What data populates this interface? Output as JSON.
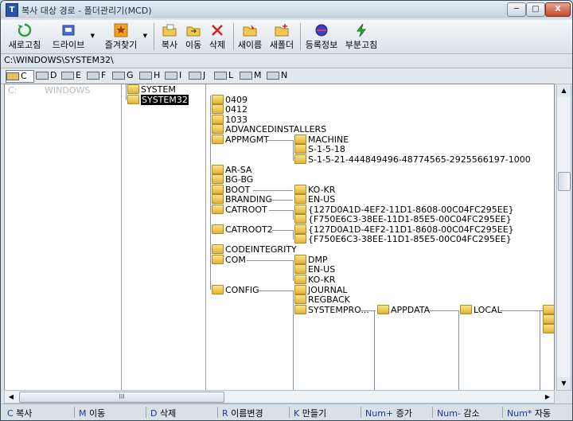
{
  "window": {
    "title": "복사 대상 경로 - 폴더관리기(MCD)",
    "icon_letter": "T"
  },
  "controls": {
    "minimize": "─",
    "maximize": "□",
    "close": "X"
  },
  "toolbar": {
    "refresh": "새로고침",
    "drive": "드라이브",
    "favorites": "즐겨찾기",
    "copy": "복사",
    "move": "이동",
    "delete": "삭제",
    "rename": "새이름",
    "new_folder": "새폴더",
    "properties": "등록정보",
    "partial_refresh": "부분고침"
  },
  "current_path": "C:\\WINDOWS\\SYSTEM32\\",
  "drives": [
    "C",
    "D",
    "E",
    "F",
    "G",
    "H",
    "I",
    "J",
    "L",
    "M",
    "N"
  ],
  "columns": {
    "col1": {
      "drive": "C:",
      "folder": "WINDOWS"
    },
    "col2": [
      "SYSTEM",
      "SYSTEM32"
    ],
    "col3": [
      "0409",
      "0412",
      "1033",
      "ADVANCEDINSTALLERS",
      "APPMGMT",
      "AR-SA",
      "BG-BG",
      "BOOT",
      "BRANDING",
      "CATROOT",
      "CATROOT2",
      "CODEINTEGRITY",
      "COM",
      "CONFIG"
    ],
    "appmgmt": [
      "MACHINE",
      "S-1-5-18",
      "S-1-5-21-444849496-48774565-2925566197-1000"
    ],
    "boot": [
      "KO-KR"
    ],
    "branding": [
      "EN-US"
    ],
    "catroot": [
      "{127D0A1D-4EF2-11D1-8608-00C04FC295EE}",
      "{F750E6C3-38EE-11D1-85E5-00C04FC295EE}"
    ],
    "catroot2": [
      "{127D0A1D-4EF2-11D1-8608-00C04FC295EE}",
      "{F750E6C3-38EE-11D1-85E5-00C04FC295EE}"
    ],
    "com": [
      "DMP",
      "EN-US",
      "KO-KR"
    ],
    "config": [
      "JOURNAL",
      "REGBACK",
      "SYSTEMPRO..."
    ],
    "systempro": [
      "APPDATA"
    ],
    "appdata": [
      "LOCAL"
    ]
  },
  "scroll": {
    "h_grip": "III"
  },
  "status_keys": [
    {
      "key": "C",
      "label": " 복사"
    },
    {
      "key": "M",
      "label": " 이동"
    },
    {
      "key": "D",
      "label": " 삭제"
    },
    {
      "key": "R",
      "label": " 이름변경"
    },
    {
      "key": "K",
      "label": " 만들기"
    },
    {
      "key": "Num+",
      "label": " 증가"
    },
    {
      "key": "Num-",
      "label": " 감소"
    },
    {
      "key": "Num*",
      "label": " 자동"
    }
  ]
}
